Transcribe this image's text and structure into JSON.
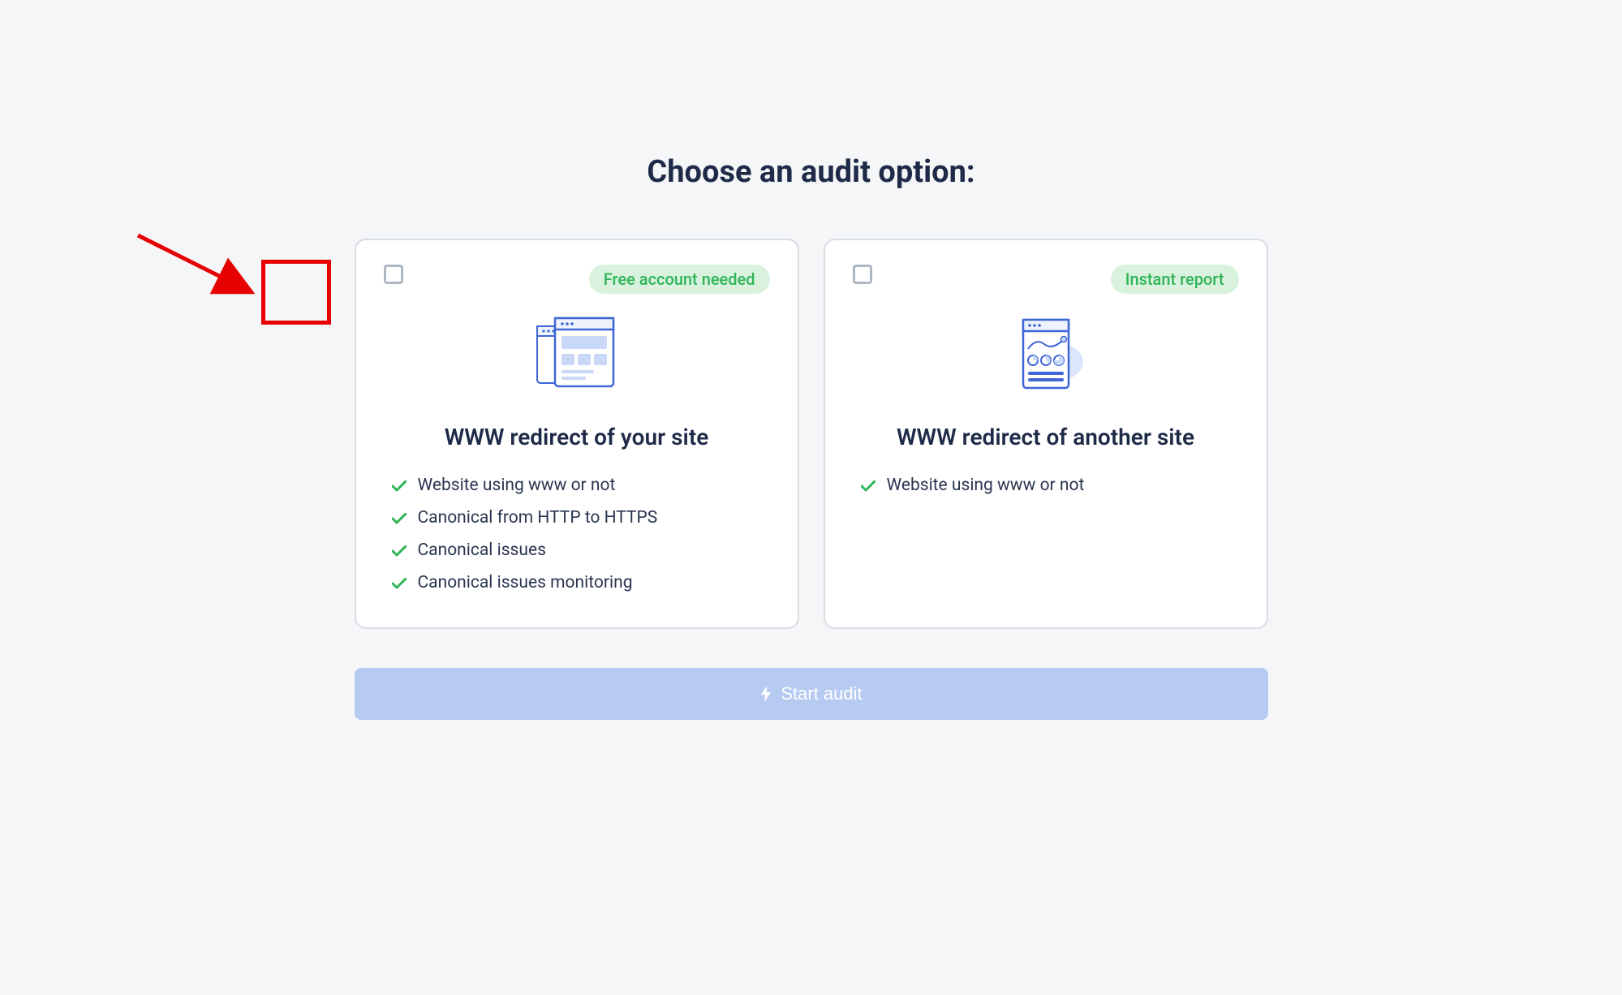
{
  "heading": "Choose an audit option:",
  "cards": [
    {
      "badge": "Free account needed",
      "title": "WWW redirect of your site",
      "features": [
        "Website using www or not",
        "Canonical from HTTP to HTTPS",
        "Canonical issues",
        "Canonical issues monitoring"
      ]
    },
    {
      "badge": "Instant report",
      "title": "WWW redirect of another site",
      "features": [
        "Website using www or not"
      ]
    }
  ],
  "start_button": "Start audit"
}
